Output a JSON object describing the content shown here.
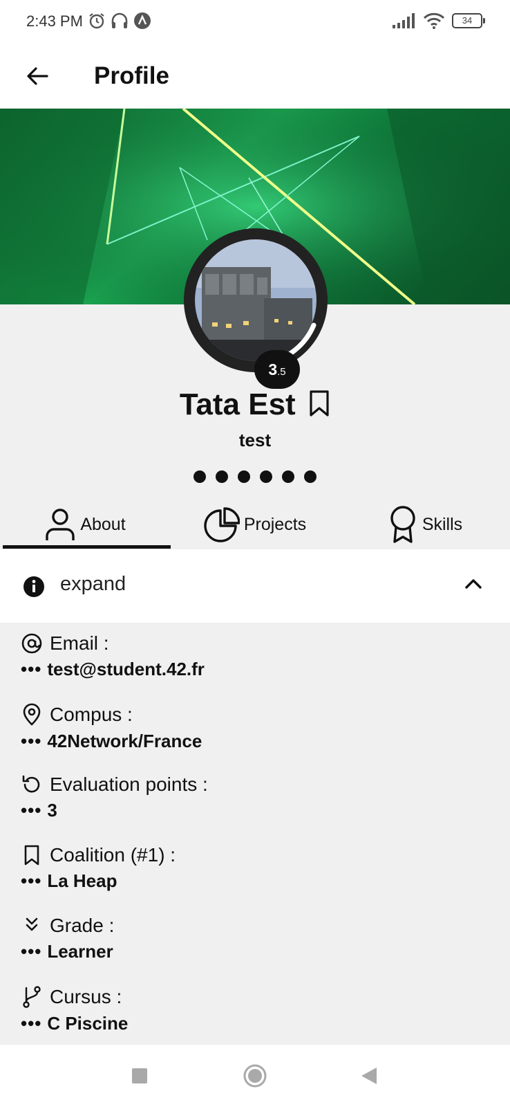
{
  "status_bar": {
    "time": "2:43 PM",
    "battery": "34",
    "icons": [
      "alarm-icon",
      "headset-icon",
      "app-a-icon",
      "signal-icon",
      "wifi-icon",
      "battery-icon"
    ]
  },
  "app_bar": {
    "title": "Profile",
    "back_icon": "arrow-left-icon"
  },
  "profile": {
    "level_main": "3",
    "level_sub": ".5",
    "name": "Tata Est",
    "login": "test",
    "dots_count": 6
  },
  "tabs": [
    {
      "label": "About",
      "icon": "person-icon",
      "active": true
    },
    {
      "label": "Projects",
      "icon": "pie-chart-icon",
      "active": false
    },
    {
      "label": "Skills",
      "icon": "award-icon",
      "active": false
    }
  ],
  "expand": {
    "label": "expand",
    "icon": "info-icon",
    "toggle_icon": "chevron-up-icon"
  },
  "details": [
    {
      "label": "Email :",
      "value": "test@student.42.fr",
      "icon": "at-icon"
    },
    {
      "label": "Compus :",
      "value": "42Network/France",
      "icon": "location-pin-icon"
    },
    {
      "label": "Evaluation points :",
      "value": "3",
      "icon": "history-icon"
    },
    {
      "label": "Coalition (#1) :",
      "value": "La Heap",
      "icon": "bookmark-icon"
    },
    {
      "label": "Grade :",
      "value": "Learner",
      "icon": "double-chevron-down-icon"
    },
    {
      "label": "Cursus :",
      "value": "C Piscine",
      "icon": "branch-icon"
    }
  ],
  "ellipsis": "•••",
  "colors": {
    "background": "#f0f0f0",
    "surface": "#ffffff",
    "text": "#111111",
    "banner_green": "#1aa350"
  }
}
